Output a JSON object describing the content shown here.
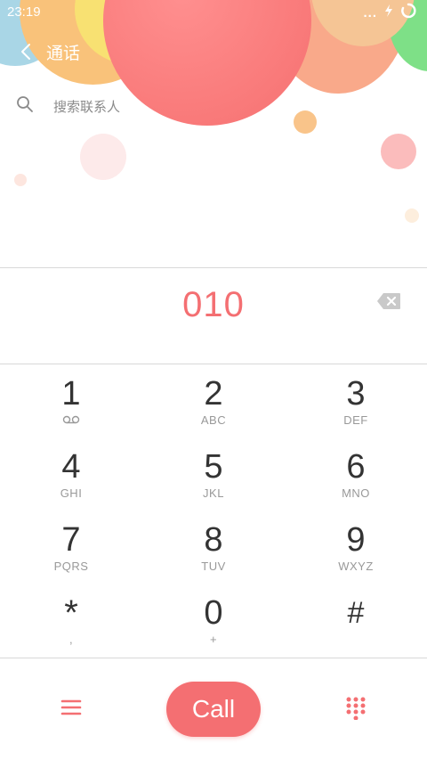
{
  "status_bar": {
    "time": "23:19",
    "dots": "..."
  },
  "header": {
    "title": "通话"
  },
  "search": {
    "placeholder": "搜索联系人"
  },
  "dialer": {
    "number": "010"
  },
  "keypad": [
    {
      "digit": "1",
      "letters": ""
    },
    {
      "digit": "2",
      "letters": "ABC"
    },
    {
      "digit": "3",
      "letters": "DEF"
    },
    {
      "digit": "4",
      "letters": "GHI"
    },
    {
      "digit": "5",
      "letters": "JKL"
    },
    {
      "digit": "6",
      "letters": "MNO"
    },
    {
      "digit": "7",
      "letters": "PQRS"
    },
    {
      "digit": "8",
      "letters": "TUV"
    },
    {
      "digit": "9",
      "letters": "WXYZ"
    },
    {
      "digit": "*",
      "letters": ","
    },
    {
      "digit": "0",
      "letters": "+"
    },
    {
      "digit": "#",
      "letters": ""
    }
  ],
  "bottom_bar": {
    "call_label": "Call"
  },
  "colors": {
    "accent": "#f46f72",
    "text": "#333333",
    "subtext": "#999999"
  },
  "icons": {
    "voicemail": "voicemail-icon",
    "backspace": "backspace-icon",
    "menu": "menu-icon",
    "dialpad": "dialpad-icon",
    "search": "search-icon",
    "back": "back-arrow-icon"
  }
}
